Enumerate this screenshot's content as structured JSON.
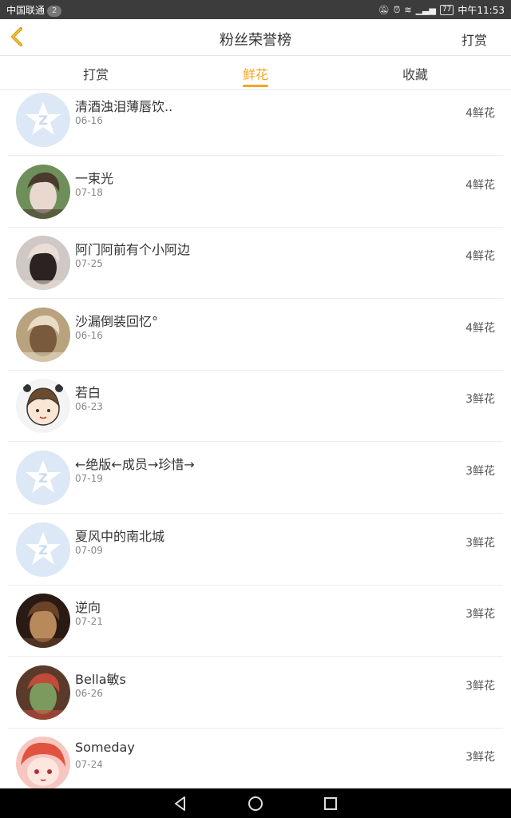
{
  "status": {
    "carrier": "中国联通",
    "sim": "2",
    "battery": "77",
    "time": "中午11:53"
  },
  "header": {
    "title": "粉丝荣誉榜",
    "action": "打赏"
  },
  "tabs": [
    {
      "label": "打赏"
    },
    {
      "label": "鲜花"
    },
    {
      "label": "收藏"
    }
  ],
  "active_tab": "鲜花",
  "colors": {
    "accent": "#f5a623",
    "status_bar": "#3c3c3c"
  },
  "items": [
    {
      "name": "清酒浊泪薄唇饮..",
      "date": "06-16",
      "count": "4鲜花",
      "avatar": "default-qq-avatar"
    },
    {
      "name": "一束光",
      "date": "07-18",
      "count": "4鲜花",
      "avatar": "user-photo"
    },
    {
      "name": "阿门阿前有个小阿边",
      "date": "07-25",
      "count": "4鲜花",
      "avatar": "user-photo"
    },
    {
      "name": "沙漏倒装回忆°",
      "date": "06-16",
      "count": "4鲜花",
      "avatar": "user-photo"
    },
    {
      "name": "若白",
      "date": "06-23",
      "count": "3鲜花",
      "avatar": "cartoon-avatar"
    },
    {
      "name": "←绝版←成员→珍惜→",
      "date": "07-19",
      "count": "3鲜花",
      "avatar": "default-qq-avatar"
    },
    {
      "name": "夏风中的南北城",
      "date": "07-09",
      "count": "3鲜花",
      "avatar": "default-qq-avatar"
    },
    {
      "name": "逆向",
      "date": "07-21",
      "count": "3鲜花",
      "avatar": "user-photo"
    },
    {
      "name": "Bella敏s",
      "date": "06-26",
      "count": "3鲜花",
      "avatar": "user-photo"
    },
    {
      "name": "Someday",
      "date": "07-24",
      "count": "3鲜花",
      "avatar": "anime-avatar"
    }
  ]
}
